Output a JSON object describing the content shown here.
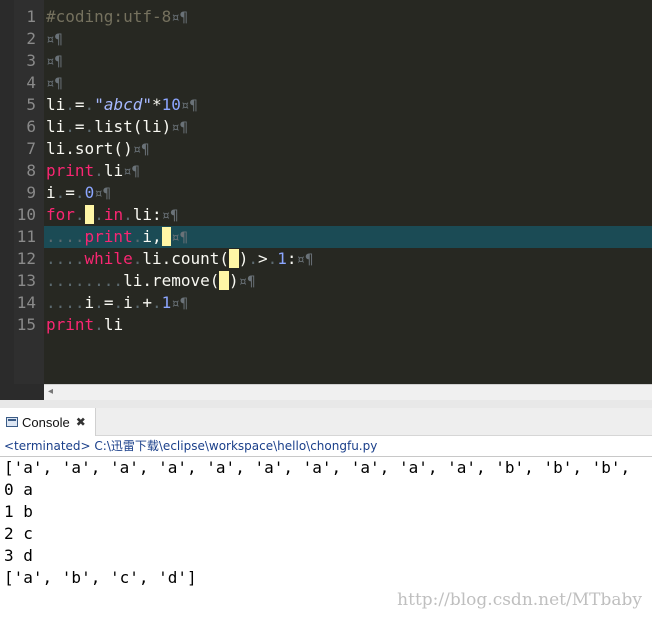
{
  "editor": {
    "line_numbers": [
      "1",
      "2",
      "3",
      "4",
      "5",
      "6",
      "7",
      "8",
      "9",
      "10",
      "11",
      "12",
      "13",
      "14",
      "15"
    ],
    "pilcrow": "¤¶",
    "l1": "#coding:utf-8",
    "l5": {
      "a": "li",
      "s": "\"abcd\"",
      "b": "*",
      "n": "10"
    },
    "l6": {
      "a": "li",
      "b": "list(li)"
    },
    "l7": "li.sort()",
    "l8": {
      "kw": "print",
      "b": "li"
    },
    "l9": {
      "a": "i",
      "n": "0"
    },
    "l10": {
      "kw": "for",
      "kw2": "in",
      "b": "li:"
    },
    "l11": {
      "kw": "print",
      "b": "i,"
    },
    "l12": {
      "kw": "while",
      "b": "li.count(",
      "c": ")",
      "op": ">",
      "n": "1",
      "colon": ":"
    },
    "l13": {
      "b": "li.remove(",
      "c": ")"
    },
    "l14": {
      "a": "i",
      "b": "i",
      "n": "1"
    },
    "l15": {
      "kw": "print",
      "b": "li"
    }
  },
  "console": {
    "tab_label": "Console",
    "close_glyph": "✖",
    "status": "<terminated> C:\\迅雷下载\\eclipse\\workspace\\hello\\chongfu.py",
    "output": [
      "['a', 'a', 'a', 'a', 'a', 'a', 'a', 'a', 'a', 'a', 'b', 'b', 'b',",
      "0 a",
      "1 b",
      "2 c",
      "3 d",
      "['a', 'b', 'c', 'd']"
    ]
  },
  "watermark": "http://blog.csdn.net/MTbaby"
}
